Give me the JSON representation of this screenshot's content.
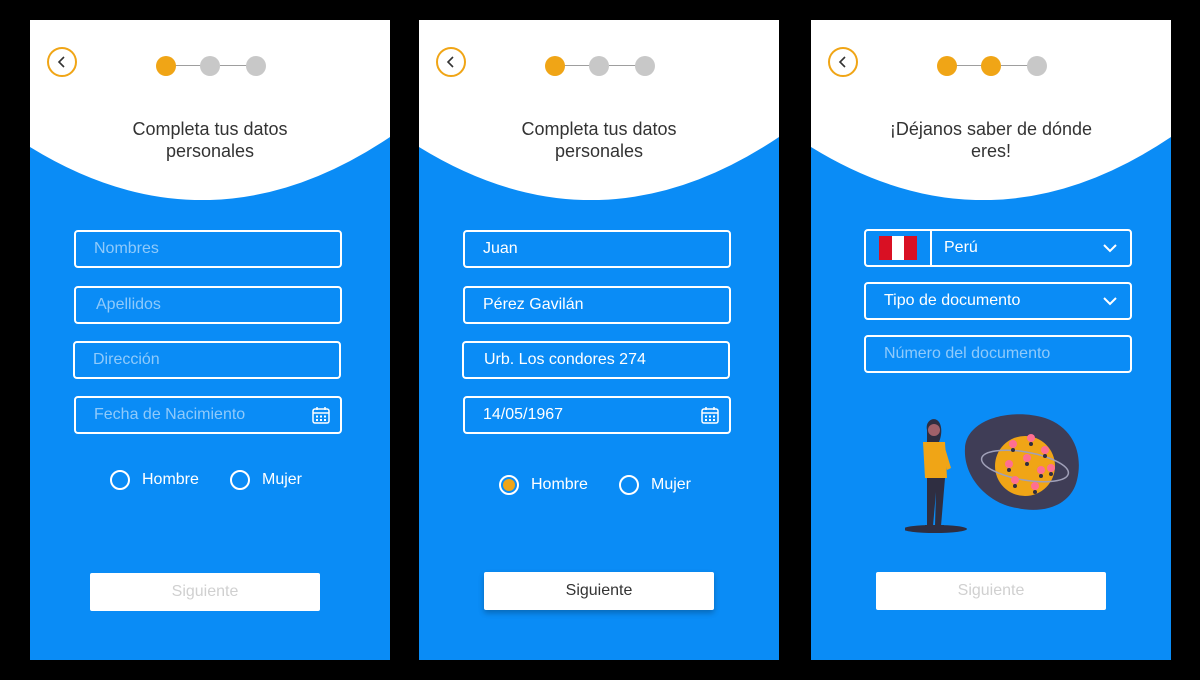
{
  "screens": [
    {
      "title_line1": "Completa tus datos",
      "title_line2": "personales",
      "fields": {
        "nombres": "Nombres",
        "apellidos": "Apellidos",
        "direccion": "Dirección",
        "fecha": "Fecha de Nacimiento"
      },
      "gender": {
        "male": "Hombre",
        "female": "Mujer",
        "selected": ""
      },
      "next_label": "Siguiente",
      "step": 1
    },
    {
      "title_line1": "Completa tus datos",
      "title_line2": "personales",
      "fields": {
        "nombres": "Juan",
        "apellidos": "Pérez Gavilán",
        "direccion": "Urb. Los condores 274",
        "fecha": "14/05/1967"
      },
      "gender": {
        "male": "Hombre",
        "female": "Mujer",
        "selected": "Hombre"
      },
      "next_label": "Siguiente",
      "step": 1
    },
    {
      "title_line1": "¡Déjanos saber de dónde",
      "title_line2": "eres!",
      "country": "Perú",
      "doc_type": "Tipo de documento",
      "doc_number_placeholder": "Número del documento",
      "next_label": "Siguiente",
      "step": 2
    }
  ],
  "colors": {
    "primary": "#0a8cf6",
    "accent": "#f0a516",
    "inactive_dot": "#c8c8c8"
  },
  "icons": [
    "back-arrow-icon",
    "calendar-icon",
    "chevron-down-icon",
    "peru-flag-icon"
  ]
}
